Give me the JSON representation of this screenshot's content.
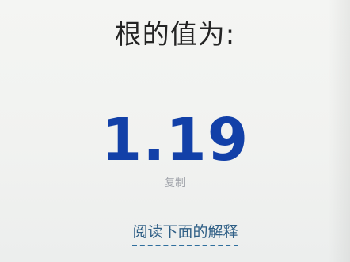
{
  "result": {
    "title": "根的值为:",
    "value": "1.19"
  },
  "actions": {
    "copy_label": "复制",
    "explain_link_label": "阅读下面的解释"
  },
  "colors": {
    "value": "#1240a8",
    "link": "#2f5f86",
    "background": "#f3f4f2"
  }
}
